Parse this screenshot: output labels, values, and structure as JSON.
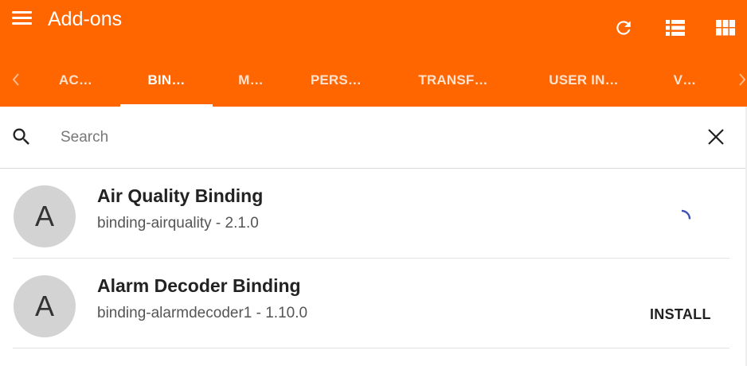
{
  "app": {
    "title": "Add-ons",
    "accent_color": "#ff6600",
    "toolbar_icons": [
      "menu-icon",
      "refresh-icon",
      "list-view-icon",
      "grid-view-icon"
    ]
  },
  "tabs": [
    {
      "label": "AC…",
      "active": false
    },
    {
      "label": "BIN…",
      "active": true
    },
    {
      "label": "M…",
      "active": false
    },
    {
      "label": "PERS…",
      "active": false
    },
    {
      "label": "TRANSF…",
      "active": false
    },
    {
      "label": "USER IN…",
      "active": false
    },
    {
      "label": "V…",
      "active": false
    }
  ],
  "search": {
    "placeholder": "Search",
    "value": ""
  },
  "addons": [
    {
      "avatar": "A",
      "name": "Air Quality Binding",
      "desc": "binding-airquality - 2.1.0",
      "status": "installing",
      "spinner_color": "#3f51b5"
    },
    {
      "avatar": "A",
      "name": "Alarm Decoder Binding",
      "desc": "binding-alarmdecoder1 - 1.10.0",
      "action": "INSTALL"
    }
  ]
}
